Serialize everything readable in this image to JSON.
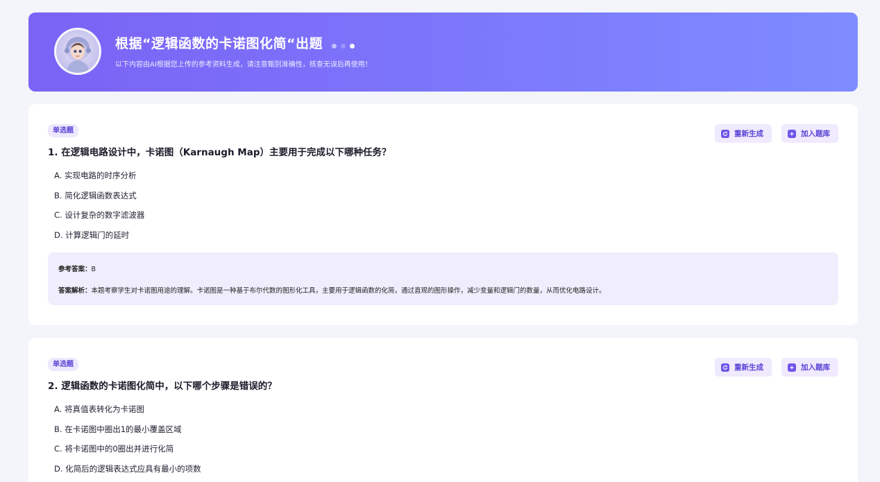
{
  "header": {
    "title": "根据“逻辑函数的卡诺图化简“出题",
    "subtitle": "以下内容由AI根据您上传的参考资料生成，请注意甄别准确性，核查无误后再使用！"
  },
  "actions": {
    "regenerate_label": "重新生成",
    "add_label": "加入题库"
  },
  "questions": [
    {
      "type": "单选题",
      "number": "1.",
      "text": "在逻辑电路设计中，卡诺图（Karnaugh Map）主要用于完成以下哪种任务？",
      "options": [
        "A. 实现电路的时序分析",
        "B. 简化逻辑函数表达式",
        "C. 设计复杂的数字滤波器",
        "D. 计算逻辑门的延时"
      ],
      "answer_label": "参考答案：",
      "answer": "B",
      "analysis_label": "答案解析：",
      "analysis": "本题考察学生对卡诺图用途的理解。卡诺图是一种基于布尔代数的图形化工具，主要用于逻辑函数的化简，通过直观的图形操作，减少变量和逻辑门的数量，从而优化电路设计。"
    },
    {
      "type": "单选题",
      "number": "2.",
      "text": "逻辑函数的卡诺图化简中，以下哪个步骤是错误的？",
      "options": [
        "A. 将真值表转化为卡诺图",
        "B. 在卡诺图中圈出1的最小覆盖区域",
        "C. 将卡诺图中的0圈出并进行化简",
        "D. 化简后的逻辑表达式应具有最小的项数"
      ]
    }
  ],
  "colors": {
    "accent": "#6e55ea",
    "banner_start": "#7a63f5",
    "banner_end": "#7f8cff",
    "answer_bg": "#f0edfc"
  },
  "icons": {
    "regenerate": "refresh-icon",
    "add": "plus-square-icon"
  }
}
